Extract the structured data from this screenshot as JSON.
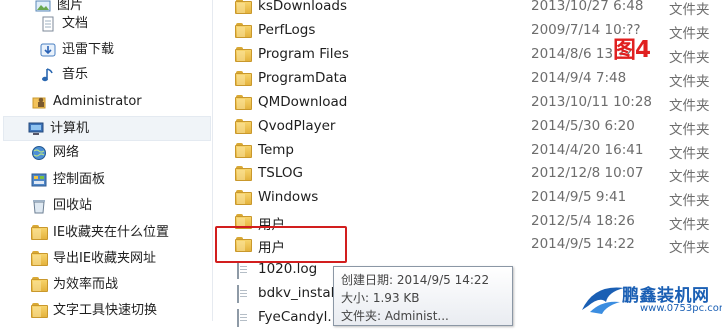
{
  "nav": {
    "items": [
      {
        "label": "图片"
      },
      {
        "label": "文档"
      },
      {
        "label": "迅雷下载"
      },
      {
        "label": "音乐"
      },
      {
        "label": "Administrator"
      },
      {
        "label": "计算机"
      },
      {
        "label": "网络"
      },
      {
        "label": "控制面板"
      },
      {
        "label": "回收站"
      },
      {
        "label": "IE收藏夹在什么位置"
      },
      {
        "label": "导出IE收藏夹网址"
      },
      {
        "label": "为效率而战"
      },
      {
        "label": "文字工具快速切换"
      }
    ]
  },
  "files": {
    "rows": [
      {
        "name": "ksDownloads",
        "date": "2013/10/27 6:48",
        "type": "文件夹"
      },
      {
        "name": "PerfLogs",
        "date": "2009/7/14 10:??",
        "type": "文件夹"
      },
      {
        "name": "Program Files",
        "date": "2014/8/6 13:??",
        "type": "文件夹"
      },
      {
        "name": "ProgramData",
        "date": "2014/9/4 7:48",
        "type": "文件夹"
      },
      {
        "name": "QMDownload",
        "date": "2013/10/11 10:28",
        "type": "文件夹"
      },
      {
        "name": "QvodPlayer",
        "date": "2014/5/30 6:20",
        "type": "文件夹"
      },
      {
        "name": "Temp",
        "date": "2014/4/20 16:41",
        "type": "文件夹"
      },
      {
        "name": "TSLOG",
        "date": "2012/12/8 10:07",
        "type": "文件夹"
      },
      {
        "name": "Windows",
        "date": "2014/9/5 9:41",
        "type": "文件夹"
      },
      {
        "name": "用户",
        "date": "2012/5/4 18:26",
        "type": "文件夹"
      },
      {
        "name": "用户",
        "date": "2014/9/5 14:22",
        "type": "文件夹"
      },
      {
        "name": "1020.log",
        "date": "",
        "type": ""
      },
      {
        "name": "bdkv_install",
        "date": "",
        "type": ""
      },
      {
        "name": "FyeCandyl...",
        "date": "",
        "type": ""
      }
    ]
  },
  "figure_label": "图4",
  "tooltip": {
    "created": "创建日期: 2014/9/5 14:22",
    "size": "大小: 1.93 KB",
    "folder": "文件夹: Administ..."
  },
  "watermark": {
    "name": "鹏鑫装机网",
    "url": "www.0753pc.com"
  },
  "colors": {
    "highlight": "#d21e1e",
    "folder": "#f0c24e",
    "brand": "#1a5fb4"
  }
}
